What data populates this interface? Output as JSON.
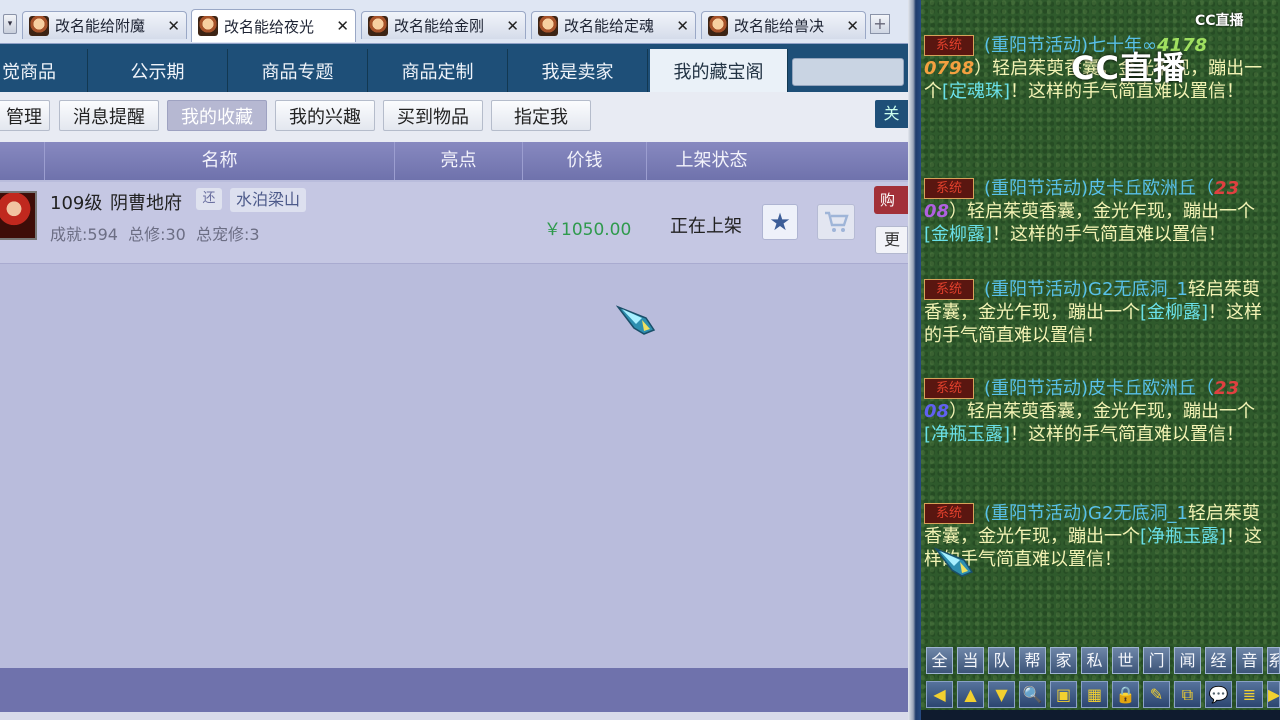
{
  "window_tabs": [
    {
      "label": "改名能给附魔",
      "close": "✕"
    },
    {
      "label": "改名能给夜光",
      "close": "✕"
    },
    {
      "label": "改名能给金刚",
      "close": "✕"
    },
    {
      "label": "改名能给定魂",
      "close": "✕"
    },
    {
      "label": "改名能给兽决",
      "close": "✕"
    }
  ],
  "tab_add": "+",
  "nav": [
    "觉商品",
    "公示期",
    "商品专题",
    "商品定制",
    "我是卖家",
    "我的藏宝阁"
  ],
  "subnav": [
    "管理",
    "消息提醒",
    "我的收藏",
    "我的兴趣",
    "买到物品",
    "指定我"
  ],
  "subnav_right": "关",
  "table_headers": [
    "名称",
    "亮点",
    "价钱",
    "上架状态"
  ],
  "row": {
    "level": "109级",
    "server": "阴曹地府",
    "badge": "还",
    "tag": "水泊梁山",
    "stats": "成就:594  总修:30  总宠修:3",
    "price": "￥1050.00",
    "status": "正在上架",
    "buy": "购",
    "more": "更"
  },
  "watermark": "CC直播",
  "watermark_small": "CC直播",
  "chat": [
    {
      "sys": "系统",
      "event": "(重阳节活动)",
      "name": "七十年∞",
      "num": "4178",
      "cont": "0798",
      "text1": "）轻启茱萸香囊，金光乍现，蹦出一个",
      "item": "[定魂珠]",
      "text2": "！这样的手气简直难以置信！"
    },
    {
      "sys": "系统",
      "event": "(重阳节活动)",
      "name": "皮卡丘欧洲丘（",
      "num": "23",
      "cont": "08",
      "text1": "）轻启茱萸香囊，金光乍现，蹦出一个",
      "item": "[金柳露]",
      "text2": "！这样的手气简直难以置信！"
    },
    {
      "sys": "系统",
      "event": "(重阳节活动)",
      "name": "G2无底洞_1",
      "text1": "轻启茱萸香囊，金光乍现，蹦出一个",
      "item": "[金柳露]",
      "text2": "！这样的手气简直难以置信！"
    },
    {
      "sys": "系统",
      "event": "(重阳节活动)",
      "name": "皮卡丘欧洲丘（",
      "num": "23",
      "cont": "08",
      "text1": "）轻启茱萸香囊，金光乍现，蹦出一个",
      "item": "[净瓶玉露]",
      "text2": "！这样的手气简直难以置信！"
    },
    {
      "sys": "系统",
      "event": "(重阳节活动)",
      "name": "G2无底洞_1",
      "text1": "轻启茱萸香囊，金光乍现，蹦出一个",
      "item": "[净瓶玉露]",
      "text2": "！这样的手气简直难以置信！"
    }
  ],
  "channels": [
    "全",
    "当",
    "队",
    "帮",
    "家",
    "私",
    "世",
    "门",
    "闻",
    "经",
    "音",
    "系"
  ],
  "tools": [
    "◀",
    "▲",
    "▼",
    "🔍",
    "▣",
    "▦",
    "🔒",
    "✎",
    "⧉",
    "💬",
    "≣",
    "▶"
  ],
  "colors": {
    "nav_bg": "#1e4f78",
    "table_header": "#7678b4",
    "price": "#2f9a4d",
    "chat_text": "#f3f3b4",
    "chat_event": "#58c0e8",
    "chat_item": "#6ae0e8",
    "sys_label": "#e0402c"
  }
}
